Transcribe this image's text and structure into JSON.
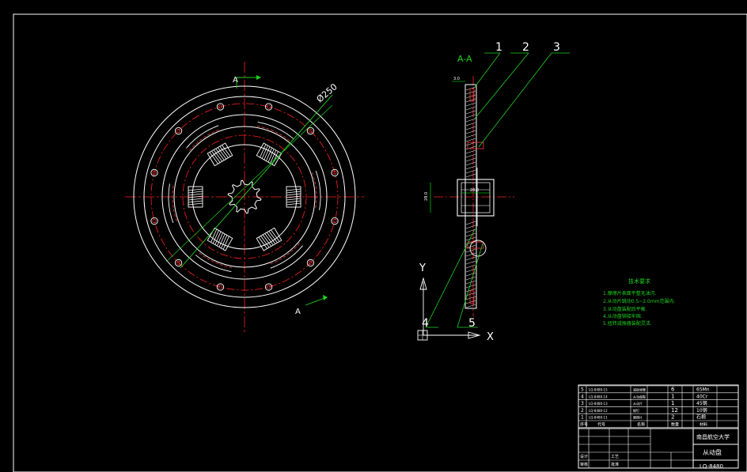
{
  "drawing": {
    "section_marker": "A",
    "diameter_label": "Ø250",
    "section_title": "A-A",
    "balloons": [
      "1",
      "2",
      "3",
      "4",
      "5"
    ],
    "hub_width_dim": "28.0",
    "hub_height_dim": "28.0",
    "top_dim": "3.0",
    "axis_y": "Y",
    "axis_x": "X"
  },
  "notes": {
    "heading": "技术要求",
    "items": [
      "1.摩擦片表面平整无油污.",
      "2.从动片跳动0.5~2.0mm范围内.",
      "3.从动盘装配后平衡.",
      "4.从动盘铆接牢固.",
      "5.扭转减振器装配灵活."
    ]
  },
  "title_block": {
    "bom_rows": [
      {
        "no": "5",
        "code": "LQ-8480-15",
        "name": "减振弹簧",
        "qty": "6",
        "material": "65Mn"
      },
      {
        "no": "4",
        "code": "LQ-8480-14",
        "name": "从动盘毂",
        "qty": "1",
        "material": "40Cr"
      },
      {
        "no": "3",
        "code": "LQ-8480-13",
        "name": "从动片",
        "qty": "1",
        "material": "45钢"
      },
      {
        "no": "2",
        "code": "LQ-8480-12",
        "name": "铆钉",
        "qty": "12",
        "material": "10钢"
      },
      {
        "no": "1",
        "code": "LQ-8480-11",
        "name": "摩擦片",
        "qty": "2",
        "material": "石棉"
      }
    ],
    "header_cells": [
      "序号",
      "代号",
      "名称",
      "数量",
      "材料"
    ],
    "school": "南昌航空大学",
    "part_name": "从动盘",
    "row_labels": [
      "设计",
      "审核",
      "工艺",
      "批准"
    ],
    "drawing_no": "LQ-8480"
  },
  "colors": {
    "background": "#000000",
    "outline": "#ffffff",
    "centerline": "#ff0000",
    "hidden": "#ff3b3b",
    "annotation": "#1fd11f",
    "dimension": "#00ff00",
    "section_fill": "#ffffff"
  }
}
